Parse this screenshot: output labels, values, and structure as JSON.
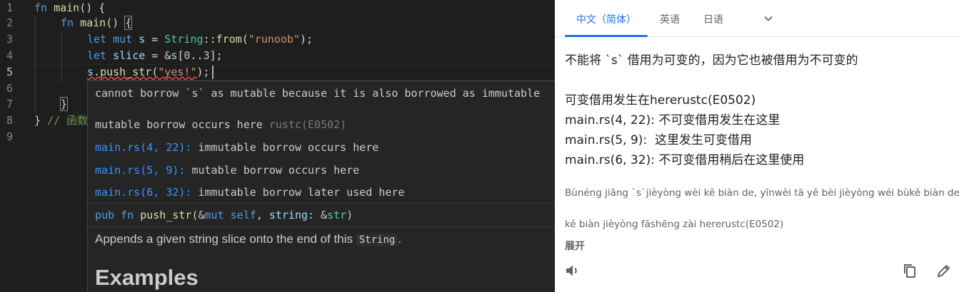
{
  "editor": {
    "line_numbers": [
      "1",
      "2",
      "3",
      "4",
      "5",
      "6",
      "7",
      "8",
      "9"
    ],
    "lines": {
      "l1": {
        "kw": "fn",
        "name": "main",
        "rest": "() {"
      },
      "l2": {
        "kw": "fn",
        "name": "main",
        "rest": "() ",
        "brace": "{"
      },
      "l3": {
        "kw1": "let",
        "kw2": "mut",
        "var": "s",
        "eq": " = ",
        "ty": "String",
        "sep": "::",
        "fn": "from",
        "open": "(",
        "str": "\"runoob\"",
        "close": ");"
      },
      "l4": {
        "kw": "let",
        "var": "slice",
        "eq": " = &",
        "var2": "s",
        "open": "[",
        "n1": "0",
        "dots": "..",
        "n2": "3",
        "close": "];"
      },
      "l5": {
        "var": "s",
        "dot": ".",
        "fn": "push_str",
        "open": "(",
        "str": "\"yes!\"",
        "close": ");"
      },
      "l7": {
        "brace": "}"
      },
      "l8": {
        "brace": "}",
        "comment": "// 函数"
      }
    }
  },
  "hover": {
    "error_message": "cannot borrow `s` as mutable because it is also borrowed as immutable",
    "related": [
      {
        "loc": "",
        "text": "mutable borrow occurs here",
        "code": "rustc(E0502)"
      },
      {
        "loc": "main.rs(4, 22):",
        "text": " immutable borrow occurs here",
        "code": ""
      },
      {
        "loc": "main.rs(5, 9):",
        "text": " mutable borrow occurs here",
        "code": ""
      },
      {
        "loc": "main.rs(6, 32):",
        "text": " immutable borrow later used here",
        "code": ""
      }
    ],
    "signature": {
      "kw1": "pub",
      "kw2": "fn",
      "name": "push_str",
      "p1": "(&",
      "kw3": "mut",
      "self": " self",
      "p2": ", ",
      "arg": "string",
      "p3": ": &",
      "ty": "str",
      "p4": ")"
    },
    "doc_before": "Appends a given string slice onto the end of this ",
    "doc_code": "String",
    "doc_after": ".",
    "doc_heading": "Examples"
  },
  "translator": {
    "tabs": [
      "中文（简体）",
      "英语",
      "日语"
    ],
    "active_tab": "中文（简体）",
    "translation_lines": [
      "不能将 `s` 借用为可变的，因为它也被借用为不可变的",
      "",
      "可变借用发生在hererustc(E0502)",
      "main.rs(4, 22): 不可变借用发生在这里",
      "main.rs(5, 9):  这里发生可变借用",
      "main.rs(6, 32): 不可变借用稍后在这里使用"
    ],
    "romanization_lines": [
      "Bùnéng jiāng `s`jièyòng wèi kě biàn de, yīnwèi tā yě bèi jièyòng wéi bùkě biàn de",
      "kě biàn jièyòng fāshēng zài hererustc(E0502)"
    ],
    "expand_label": "展开"
  }
}
